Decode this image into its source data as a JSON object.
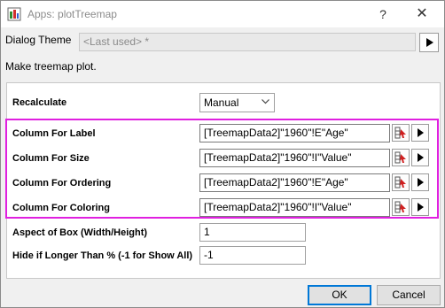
{
  "window": {
    "title": "Apps: plotTreemap",
    "help_glyph": "?",
    "close_glyph": "✕"
  },
  "theme": {
    "label": "Dialog Theme",
    "value": "<Last used> *"
  },
  "description": "Make treemap plot.",
  "recalculate": {
    "label": "Recalculate",
    "value": "Manual"
  },
  "columns": [
    {
      "label": "Column For Label",
      "value": "[TreemapData2]\"1960\"!E\"Age\""
    },
    {
      "label": "Column For Size",
      "value": "[TreemapData2]\"1960\"!I\"Value\""
    },
    {
      "label": "Column For Ordering",
      "value": "[TreemapData2]\"1960\"!E\"Age\""
    },
    {
      "label": "Column For Coloring",
      "value": "[TreemapData2]\"1960\"!I\"Value\""
    }
  ],
  "aspect": {
    "label": "Aspect of Box (Width/Height)",
    "value": "1"
  },
  "hide": {
    "label": "Hide if Longer Than % (-1 for Show All)",
    "value": "-1"
  },
  "buttons": {
    "ok": "OK",
    "cancel": "Cancel"
  },
  "colors": {
    "highlight": "#e020e0",
    "ok_border": "#0078d7"
  }
}
